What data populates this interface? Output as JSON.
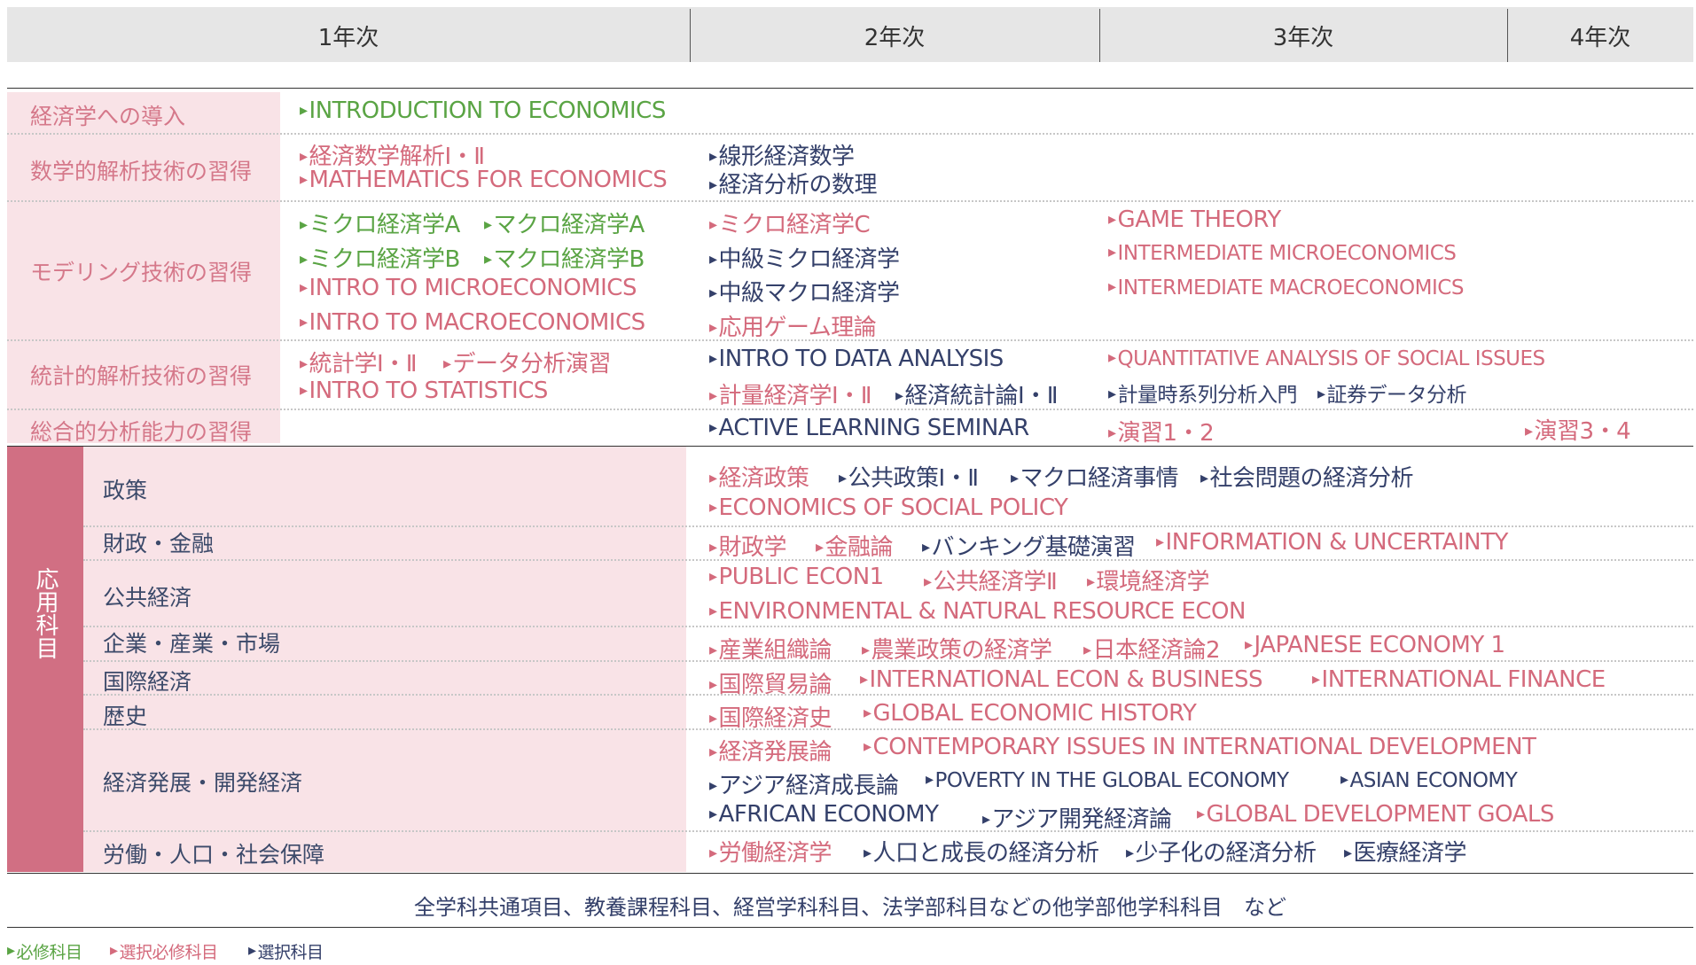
{
  "header": {
    "years": [
      "1年次",
      "2年次",
      "3年次",
      "4年次"
    ]
  },
  "categories": {
    "intro": "経済学への導入",
    "math": "数学的解析技術の習得",
    "model": "モデリング技術の習得",
    "stat": "統計的解析技術の習得",
    "comp": "総合的分析能力の習得"
  },
  "applied": {
    "title": "応用科目",
    "subs": [
      "政策",
      "財政・金融",
      "公共経済",
      "企業・産業・市場",
      "国際経済",
      "歴史",
      "経済発展・開発経済",
      "労働・人口・社会保障"
    ]
  },
  "courses": {
    "intro": [
      "INTRODUCTION TO ECONOMICS"
    ],
    "math": [
      "経済数学解析Ⅰ・Ⅱ",
      "MATHEMATICS FOR ECONOMICS",
      "線形経済数学",
      "経済分析の数理"
    ],
    "model": [
      "ミクロ経済学A",
      "マクロ経済学A",
      "ミクロ経済学B",
      "マクロ経済学B",
      "INTRO TO MICROECONOMICS",
      "INTRO TO MACROECONOMICS",
      "ミクロ経済学C",
      "中級ミクロ経済学",
      "中級マクロ経済学",
      "応用ゲーム理論",
      "GAME THEORY",
      "INTERMEDIATE MICROECONOMICS",
      "INTERMEDIATE MACROECONOMICS"
    ],
    "stat": [
      "統計学Ⅰ・Ⅱ",
      "データ分析演習",
      "INTRO TO STATISTICS",
      "INTRO TO DATA ANALYSIS",
      "計量経済学Ⅰ・Ⅱ",
      "経済統計論Ⅰ・Ⅱ",
      "QUANTITATIVE ANALYSIS OF SOCIAL ISSUES",
      "計量時系列分析入門",
      "証券データ分析"
    ],
    "comp": [
      "ACTIVE LEARNING SEMINAR",
      "演習1・2",
      "演習3・4"
    ],
    "policy": [
      "経済政策",
      "公共政策Ⅰ・Ⅱ",
      "マクロ経済事情",
      "社会問題の経済分析",
      "ECONOMICS OF SOCIAL POLICY"
    ],
    "finance": [
      "財政学",
      "金融論",
      "バンキング基礎演習",
      "INFORMATION & UNCERTAINTY"
    ],
    "public": [
      "PUBLIC ECON1",
      "公共経済学Ⅱ",
      "環境経済学",
      "ENVIRONMENTAL & NATURAL RESOURCE ECON"
    ],
    "industry": [
      "産業組織論",
      "農業政策の経済学",
      "日本経済論2",
      "JAPANESE ECONOMY 1"
    ],
    "intl": [
      "国際貿易論",
      "INTERNATIONAL ECON & BUSINESS",
      "INTERNATIONAL FINANCE"
    ],
    "history": [
      "国際経済史",
      "GLOBAL ECONOMIC HISTORY"
    ],
    "dev": [
      "経済発展論",
      "CONTEMPORARY ISSUES IN INTERNATIONAL DEVELOPMENT",
      "アジア経済成長論",
      "POVERTY IN THE GLOBAL ECONOMY",
      "ASIAN ECONOMY",
      "AFRICAN ECONOMY",
      "アジア開発経済論",
      "GLOBAL DEVELOPMENT GOALS"
    ],
    "labor": [
      "労働経済学",
      "人口と成長の経済分析",
      "少子化の経済分析",
      "医療経済学"
    ]
  },
  "footer": {
    "note": "全学科共通項目、教養課程科目、経営学科科目、法学部科目などの他学部他学科科目　など"
  },
  "legend": [
    "必修科目",
    "選択必修科目",
    "選択科目"
  ],
  "colors": {
    "required": "#5aa444",
    "elective_required": "#d46a7c",
    "elective": "#34406a",
    "category_bg": "#f9e3e7",
    "applied_bg": "#d16f83"
  }
}
